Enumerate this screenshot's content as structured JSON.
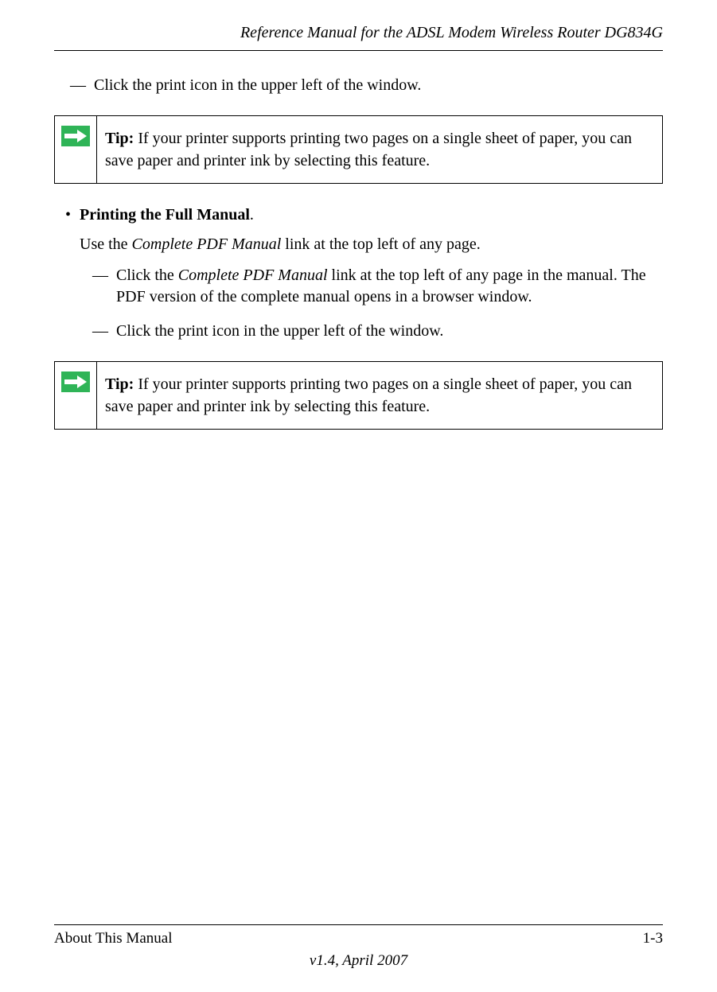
{
  "header": {
    "title": "Reference Manual for the ADSL Modem Wireless Router DG834G"
  },
  "body": {
    "dash_item1": "Click the print icon in the upper left of the window.",
    "tip1": {
      "label": "Tip:",
      "text": " If your printer supports printing two pages on a single sheet of paper, you can save paper and printer ink by selecting this feature."
    },
    "bullet1": {
      "bold": "Printing the Full Manual",
      "tail": "."
    },
    "sub_line1_prefix": "Use the ",
    "sub_line1_italic": "Complete PDF Manual",
    "sub_line1_tail": " link at the top left of any page.",
    "dash2": {
      "prefix": "Click the ",
      "italic": "Complete PDF Manual",
      "tail": " link at the top left of any page in the manual. The PDF version of the complete manual opens in a browser window."
    },
    "dash3": "Click the print icon in the upper left of the window.",
    "tip2": {
      "label": "Tip:",
      "text": " If your printer supports printing two pages on a single sheet of paper, you can save paper and printer ink by selecting this feature."
    }
  },
  "footer": {
    "left": "About This Manual",
    "right": "1-3",
    "version": "v1.4, April 2007"
  },
  "icons": {
    "arrow_color": "#27a844"
  }
}
